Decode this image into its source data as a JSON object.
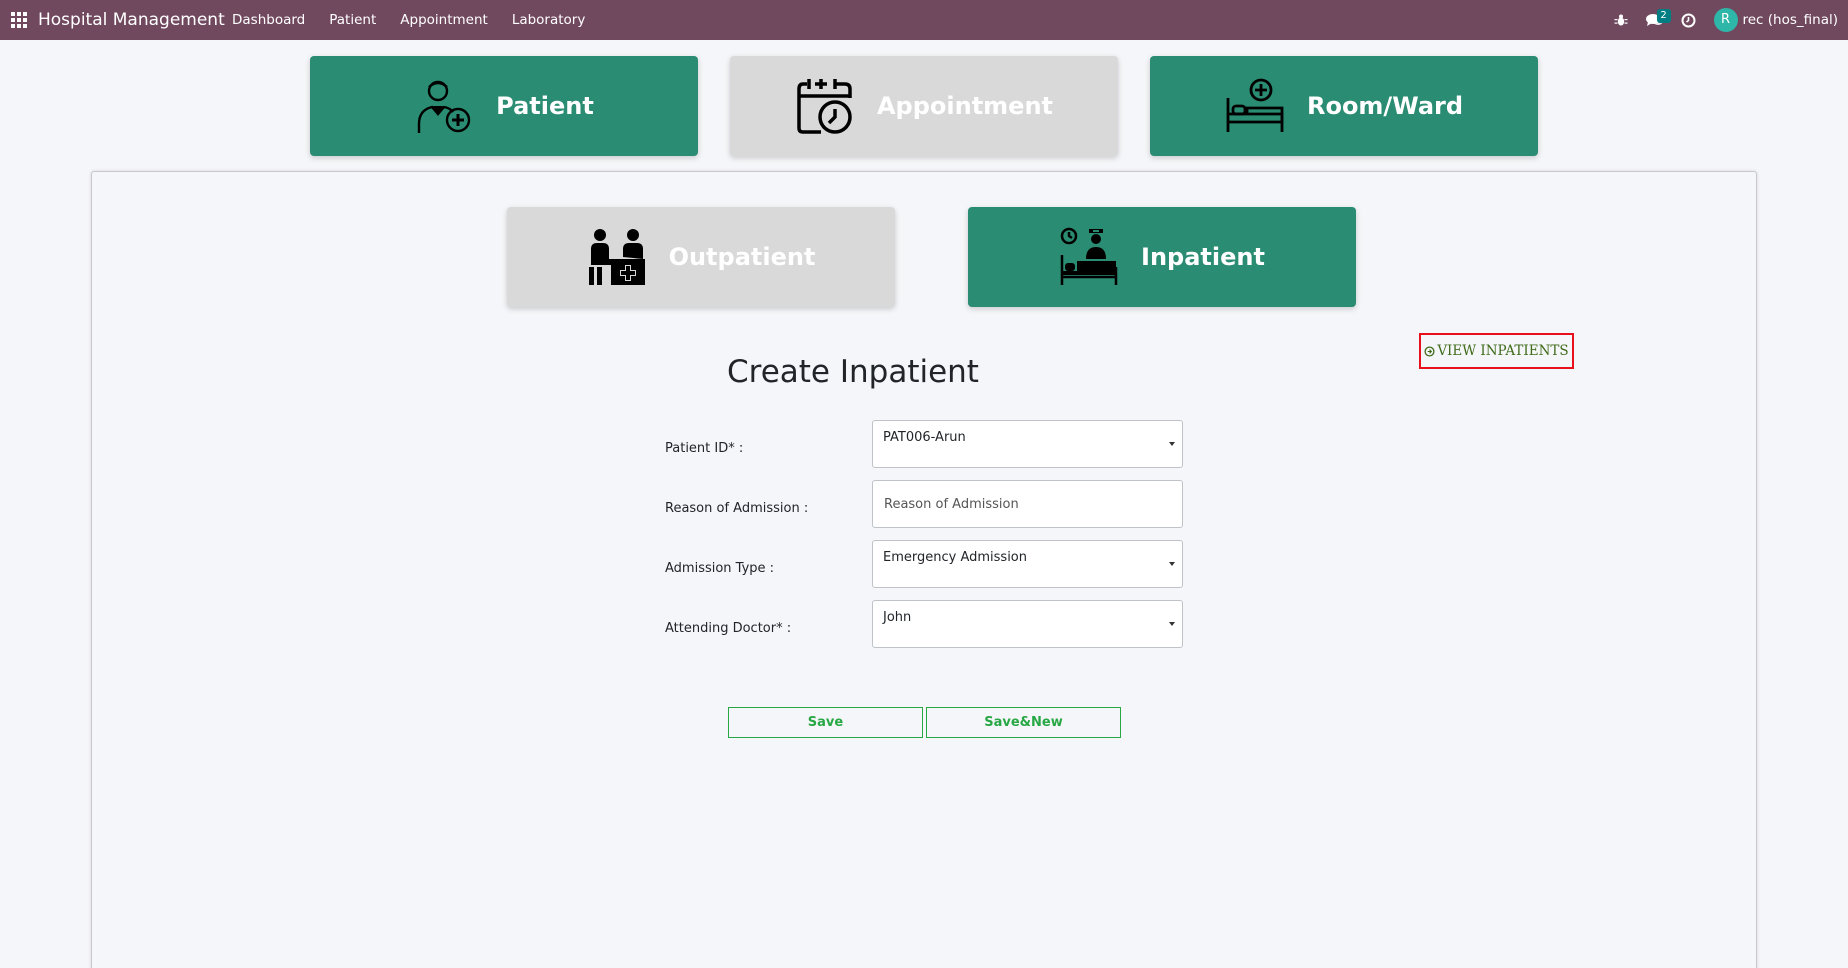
{
  "navbar": {
    "brand": "Hospital Management",
    "menu": [
      "Dashboard",
      "Patient",
      "Appointment",
      "Laboratory"
    ],
    "chat_count": "2",
    "user_initial": "R",
    "user_name": "rec (hos_final)"
  },
  "top_tiles": [
    {
      "label": "Patient",
      "active": true,
      "icon": "patient-add-icon"
    },
    {
      "label": "Appointment",
      "active": false,
      "icon": "calendar-clock-icon"
    },
    {
      "label": "Room/Ward",
      "active": true,
      "icon": "hospital-bed-icon"
    }
  ],
  "sub_tiles": [
    {
      "label": "Outpatient",
      "active": false,
      "icon": "doctor-desk-icon"
    },
    {
      "label": "Inpatient",
      "active": true,
      "icon": "inpatient-bed-icon"
    }
  ],
  "view_button": "VIEW INPATIENTS",
  "form": {
    "title": "Create Inpatient",
    "fields": [
      {
        "label": "Patient ID* :",
        "value": "PAT006-Arun",
        "type": "select"
      },
      {
        "label": "Reason of Admission :",
        "placeholder": "Reason of Admission",
        "type": "text"
      },
      {
        "label": "Admission Type :",
        "value": "Emergency Admission",
        "type": "select"
      },
      {
        "label": "Attending Doctor* :",
        "value": "John",
        "type": "select"
      }
    ],
    "save_label": "Save",
    "save_new_label": "Save&New"
  },
  "colors": {
    "navbar": "#71495f",
    "tile_active": "#2a8c72",
    "tile_inactive": "#d9d9d9",
    "button_green": "#28a745",
    "highlight_red": "#e8101a"
  }
}
